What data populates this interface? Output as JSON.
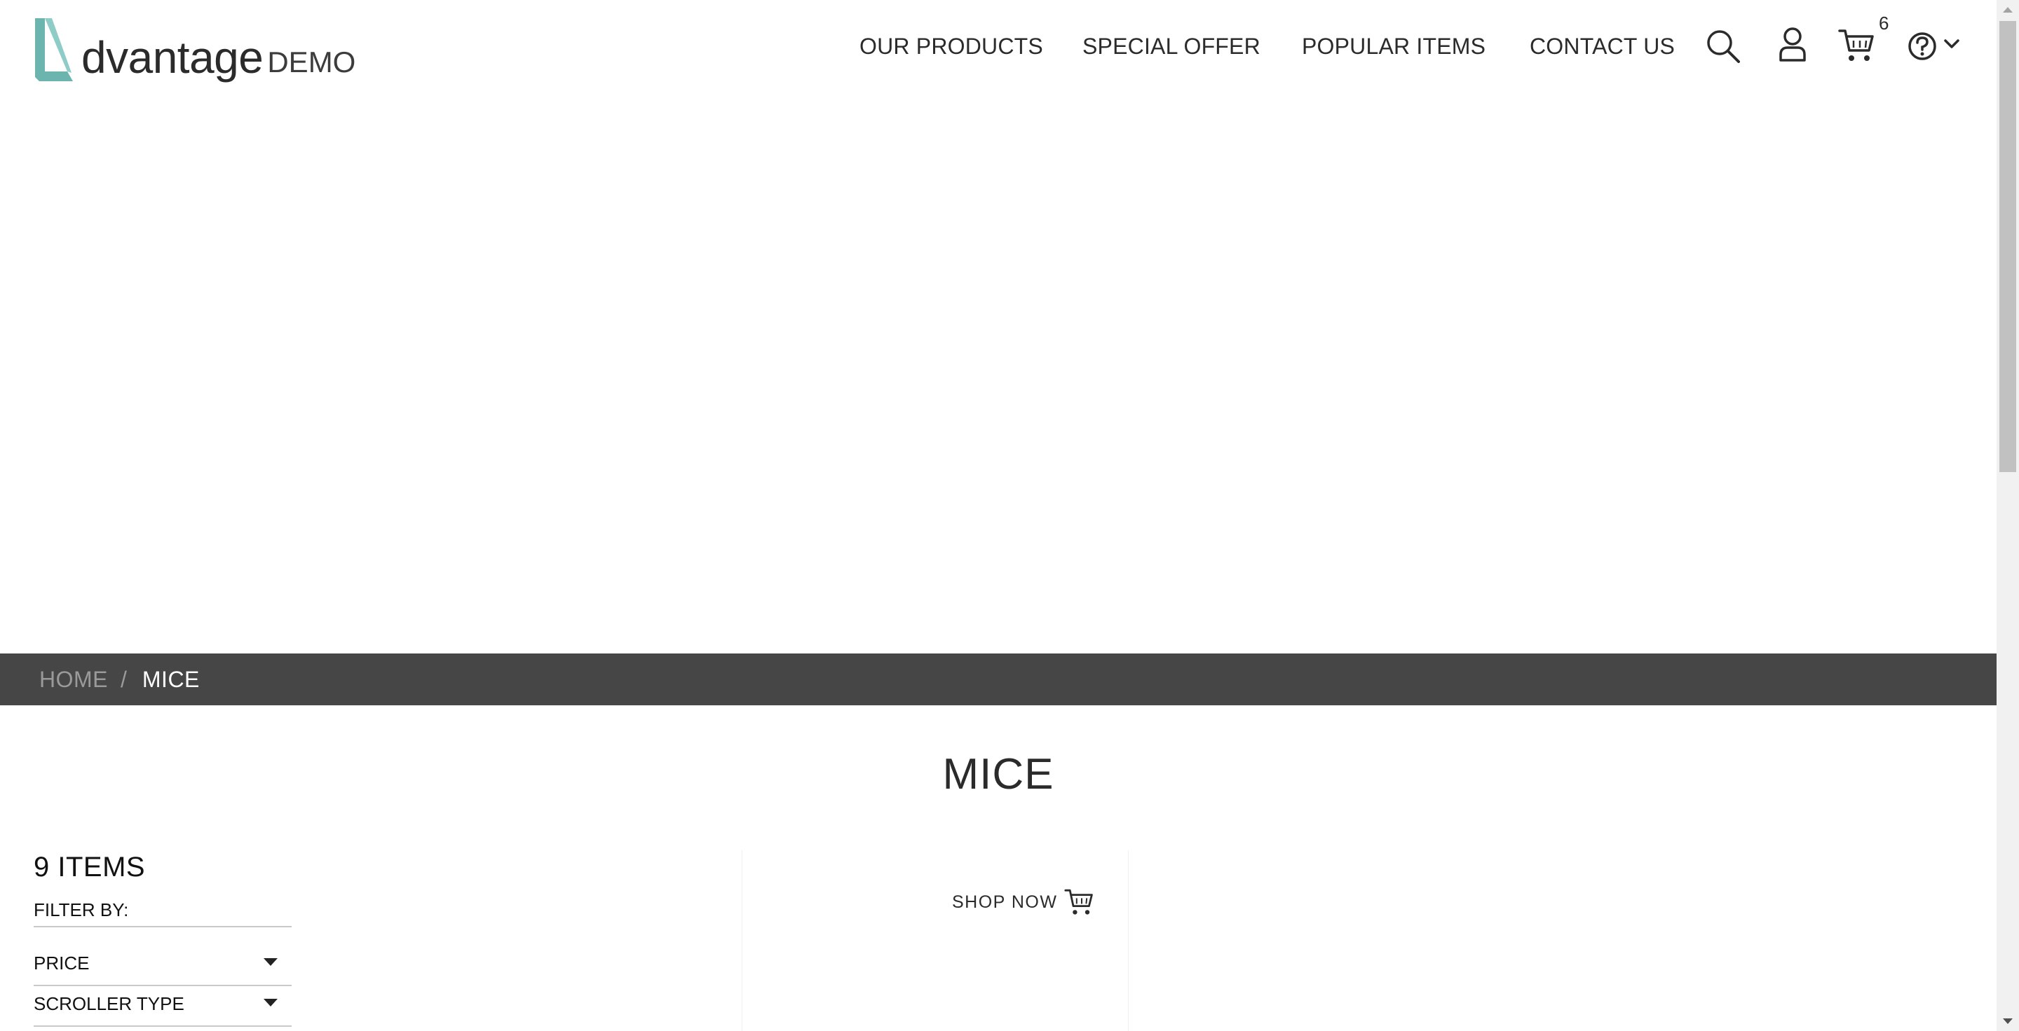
{
  "brand": {
    "name": "dvantage",
    "suffix": "DEMO",
    "accent_color": "#6bb5ae"
  },
  "nav": [
    {
      "label": "OUR PRODUCTS"
    },
    {
      "label": "SPECIAL OFFER"
    },
    {
      "label": "POPULAR ITEMS"
    },
    {
      "label": "CONTACT US"
    }
  ],
  "header_icons": [
    "search-icon",
    "user-icon",
    "cart-icon",
    "help-icon",
    "chevron-down-icon"
  ],
  "cart": {
    "count": "6"
  },
  "breadcrumb": {
    "home": "HOME",
    "separator": "/",
    "current": "MICE"
  },
  "page": {
    "title": "MICE"
  },
  "filters": {
    "items_count": "9 ITEMS",
    "filter_by": "FILTER BY:",
    "rows": [
      {
        "label": "PRICE"
      },
      {
        "label": "SCROLLER TYPE"
      }
    ]
  },
  "promo": {
    "shop_now": "SHOP NOW"
  },
  "colors": {
    "breadcrumb_bg": "#464646",
    "text": "#2b2b2b"
  }
}
